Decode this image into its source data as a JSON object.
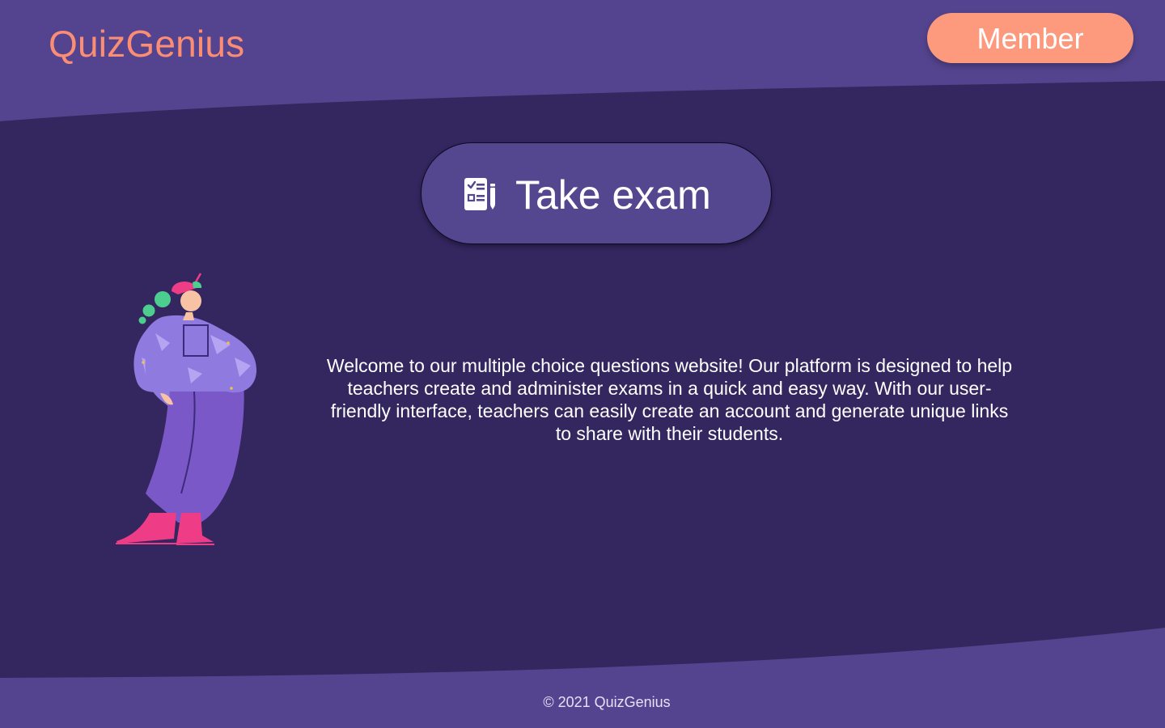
{
  "header": {
    "brand": "QuizGenius",
    "member_label": "Member"
  },
  "hero": {
    "exam_button_label": "Take exam",
    "exam_icon": "exam-checklist-icon"
  },
  "main": {
    "welcome_text": "Welcome to our multiple choice questions website! Our platform is designed to help teachers create and administer exams in a quick and easy way. With our user-friendly interface, teachers can easily create an account and generate unique links to share with their students.",
    "illustration": "thinking-person-illustration"
  },
  "footer": {
    "copyright": "© 2021 QuizGenius"
  },
  "colors": {
    "band": "#54448f",
    "body": "#34265f",
    "brand": "#fb8d74",
    "member_button": "#fd9a7d",
    "exam_button": "#54468f"
  }
}
